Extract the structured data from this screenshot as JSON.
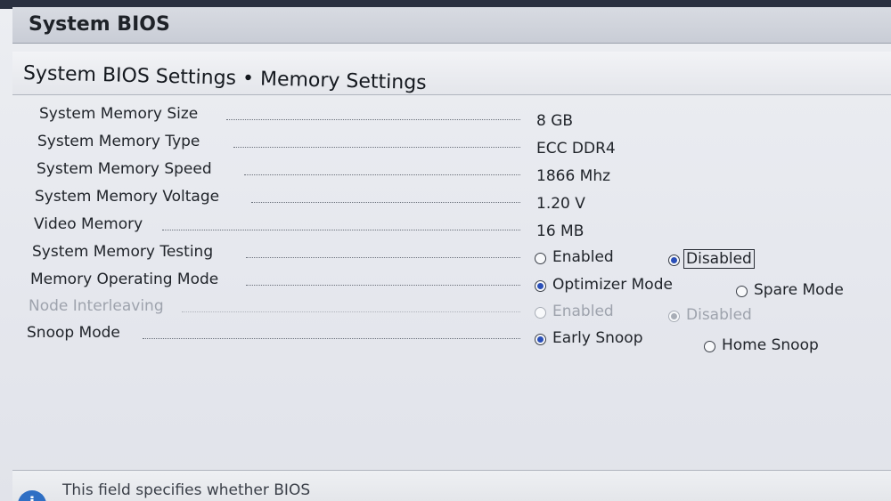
{
  "window": {
    "title": "System BIOS"
  },
  "header": {
    "title": "System BIOS Settings • Memory Settings"
  },
  "settings": [
    {
      "label": "System Memory Size",
      "value": "8 GB"
    },
    {
      "label": "System Memory Type",
      "value": "ECC DDR4"
    },
    {
      "label": "System Memory Speed",
      "value": "1866 Mhz"
    },
    {
      "label": "System Memory Voltage",
      "value": "1.20 V"
    },
    {
      "label": "Video Memory",
      "value": "16 MB"
    },
    {
      "label": "System Memory Testing",
      "options": [
        "Enabled",
        "Disabled"
      ],
      "selected": "Disabled"
    },
    {
      "label": "Memory Operating Mode",
      "options": [
        "Optimizer Mode",
        "Spare Mode"
      ],
      "selected": "Optimizer Mode"
    },
    {
      "label": "Node Interleaving",
      "options": [
        "Enabled",
        "Disabled"
      ],
      "selected": "Disabled"
    },
    {
      "label": "Snoop Mode",
      "options": [
        "Early Snoop",
        "Home Snoop"
      ],
      "selected": "Early Snoop"
    }
  ],
  "help": {
    "text": "This field specifies whether BIOS"
  },
  "icons": {
    "info": "info-icon"
  }
}
